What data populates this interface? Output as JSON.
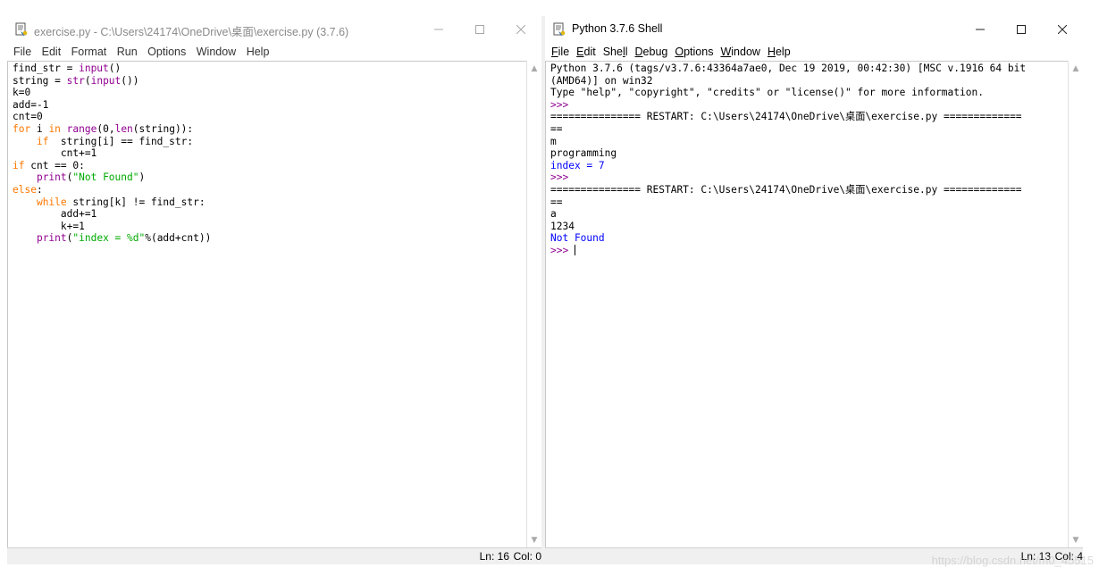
{
  "editor": {
    "title": "exercise.py - C:\\Users\\24174\\OneDrive\\桌面\\exercise.py (3.7.6)",
    "menu": [
      "File",
      "Edit",
      "Format",
      "Run",
      "Options",
      "Window",
      "Help"
    ],
    "status": {
      "ln": "Ln: 16",
      "col": "Col: 0"
    },
    "code_lines": [
      [
        {
          "t": "find_str = "
        },
        {
          "t": "input",
          "c": "bi"
        },
        {
          "t": "()"
        }
      ],
      [
        {
          "t": "string = "
        },
        {
          "t": "str",
          "c": "bi"
        },
        {
          "t": "("
        },
        {
          "t": "input",
          "c": "bi"
        },
        {
          "t": "())"
        }
      ],
      [
        {
          "t": "k=0"
        }
      ],
      [
        {
          "t": "add=-1"
        }
      ],
      [
        {
          "t": "cnt=0"
        }
      ],
      [
        {
          "t": "for",
          "c": "kw"
        },
        {
          "t": " i "
        },
        {
          "t": "in",
          "c": "kw"
        },
        {
          "t": " "
        },
        {
          "t": "range",
          "c": "bi"
        },
        {
          "t": "(0,"
        },
        {
          "t": "len",
          "c": "bi"
        },
        {
          "t": "(string)):"
        }
      ],
      [
        {
          "t": "    "
        },
        {
          "t": "if",
          "c": "kw"
        },
        {
          "t": "  string[i] == find_str:"
        }
      ],
      [
        {
          "t": "        cnt+=1"
        }
      ],
      [
        {
          "t": "if",
          "c": "kw"
        },
        {
          "t": " cnt == 0:"
        }
      ],
      [
        {
          "t": "    "
        },
        {
          "t": "print",
          "c": "bi"
        },
        {
          "t": "("
        },
        {
          "t": "\"Not Found\"",
          "c": "str"
        },
        {
          "t": ")"
        }
      ],
      [
        {
          "t": "else",
          "c": "kw"
        },
        {
          "t": ":"
        }
      ],
      [
        {
          "t": "    "
        },
        {
          "t": "while",
          "c": "kw"
        },
        {
          "t": " string[k] != find_str:"
        }
      ],
      [
        {
          "t": "        add+=1"
        }
      ],
      [
        {
          "t": "        k+=1"
        }
      ],
      [
        {
          "t": "    "
        },
        {
          "t": "print",
          "c": "bi"
        },
        {
          "t": "("
        },
        {
          "t": "\"index = %d\"",
          "c": "str"
        },
        {
          "t": "%(add+cnt))"
        }
      ]
    ]
  },
  "shell": {
    "title": "Python 3.7.6 Shell",
    "menu": [
      "File",
      "Edit",
      "Shell",
      "Debug",
      "Options",
      "Window",
      "Help"
    ],
    "menu_underline": [
      0,
      0,
      3,
      0,
      0,
      0,
      0
    ],
    "status": {
      "ln": "Ln: 13",
      "col": "Col: 4"
    },
    "lines": [
      [
        {
          "t": "Python 3.7.6 (tags/v3.7.6:43364a7ae0, Dec 19 2019, 00:42:30) [MSC v.1916 64 bit"
        }
      ],
      [
        {
          "t": "(AMD64)] on win32"
        }
      ],
      [
        {
          "t": "Type \"help\", \"copyright\", \"credits\" or \"license()\" for more information."
        }
      ],
      [
        {
          "t": ">>> ",
          "c": "bi"
        }
      ],
      [
        {
          "t": "=============== RESTART: C:\\Users\\24174\\OneDrive\\桌面\\exercise.py ============="
        }
      ],
      [
        {
          "t": "=="
        }
      ],
      [
        {
          "t": "m"
        }
      ],
      [
        {
          "t": "programming"
        }
      ],
      [
        {
          "t": "index = 7",
          "c": "out"
        }
      ],
      [
        {
          "t": ">>> ",
          "c": "bi"
        }
      ],
      [
        {
          "t": "=============== RESTART: C:\\Users\\24174\\OneDrive\\桌面\\exercise.py ============="
        }
      ],
      [
        {
          "t": "=="
        }
      ],
      [
        {
          "t": "a"
        }
      ],
      [
        {
          "t": "1234"
        }
      ],
      [
        {
          "t": "Not Found",
          "c": "out"
        }
      ],
      [
        {
          "t": ">>> ",
          "c": "bi"
        },
        {
          "cursor": true
        }
      ]
    ]
  },
  "watermark": "https://blog.csdn.net/m0_45515",
  "colors": {
    "keyword": "#ff7700",
    "builtin": "#900090",
    "string": "#00aa00",
    "output": "#0000ff"
  }
}
